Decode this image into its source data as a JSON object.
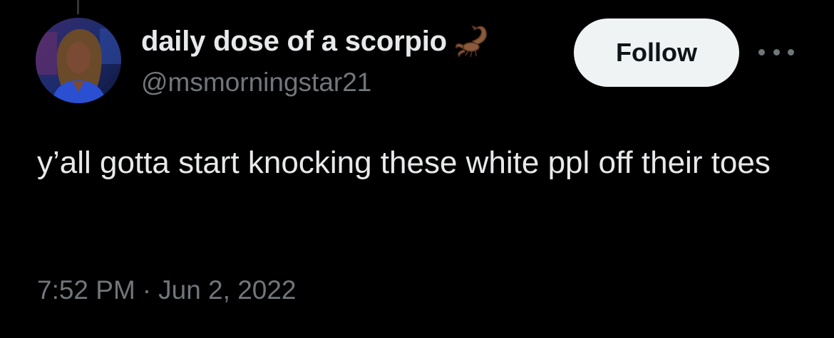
{
  "tweet": {
    "author": {
      "display_name": "daily dose of a scorpio",
      "name_emoji_icon": "scorpion-icon",
      "handle": "@msmorningstar21",
      "avatar_icon": "avatar"
    },
    "follow_label": "Follow",
    "more_icon": "more-horizontal-icon",
    "text": "y’all gotta start knocking these white ppl off their toes",
    "time": "7:52 PM",
    "separator": "·",
    "date": "Jun 2, 2022"
  },
  "colors": {
    "background": "#000000",
    "primary_text": "#e7e9ea",
    "secondary_text": "#71767b",
    "button_bg": "#eff3f4",
    "button_text": "#0f1419"
  }
}
